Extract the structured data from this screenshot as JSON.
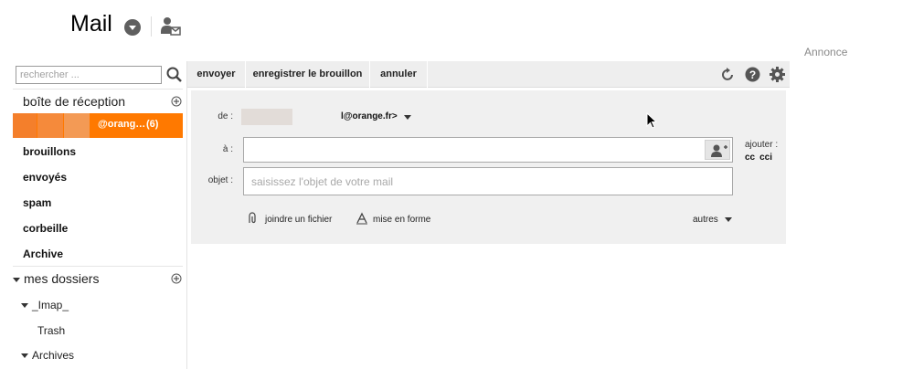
{
  "header": {
    "app_title": "Mail",
    "title_dropdown_icon": "chevron-down-circle-icon",
    "contacts_icon": "contact-mail-icon",
    "ad_label": "Annonce"
  },
  "sidebar": {
    "search_placeholder": "rechercher ...",
    "search_icon": "search-icon",
    "inbox_label": "boîte de réception",
    "inbox_add_icon": "plus-circle-icon",
    "account": {
      "name": "@orang…",
      "count": "(6)"
    },
    "folders": [
      "brouillons",
      "envoyés",
      "spam",
      "corbeille",
      "Archive"
    ],
    "my_folders_label": "mes dossiers",
    "my_folders_add_icon": "plus-circle-icon",
    "subfolders": [
      {
        "label": "_Imap_",
        "expanded": true
      },
      {
        "label": "Trash",
        "expanded": false
      },
      {
        "label": "Archives",
        "expanded": true
      }
    ]
  },
  "toolbar": {
    "send_label": "envoyer",
    "save_draft_label": "enregistrer le brouillon",
    "cancel_label": "annuler",
    "refresh_icon": "refresh-icon",
    "help_icon": "help-icon",
    "settings_icon": "gear-icon"
  },
  "compose": {
    "from_label": "de :",
    "from_address": "l@orange.fr>",
    "to_label": "à :",
    "to_value": "",
    "add_label": "ajouter :",
    "cc_label": "cc",
    "cci_label": "cci",
    "subject_label": "objet :",
    "subject_placeholder": "saisissez l'objet de votre mail",
    "attach_label": "joindre un fichier",
    "format_label": "mise en forme",
    "more_label": "autres"
  },
  "colors": {
    "accent": "#ff7900",
    "toolbar_bg": "#eeeeee",
    "compose_bg": "#f0f0f0"
  }
}
